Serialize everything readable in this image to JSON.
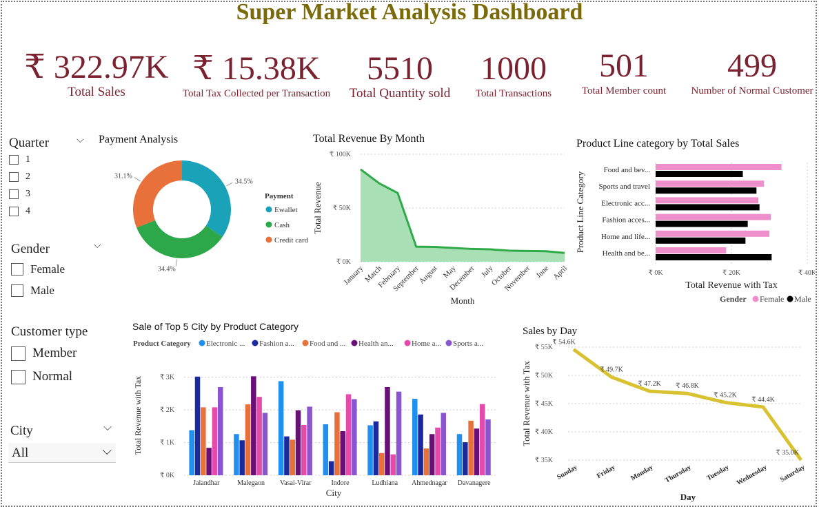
{
  "title": "Super Market Analysis Dashboard",
  "kpis": [
    {
      "value": "₹ 322.97K",
      "label": "Total Sales"
    },
    {
      "value": "₹ 15.38K",
      "label": "Total Tax Collected per Transaction"
    },
    {
      "value": "5510",
      "label": "Total Quantity sold"
    },
    {
      "value": "1000",
      "label": "Total Transactions"
    },
    {
      "value": "501",
      "label": "Total Member count"
    },
    {
      "value": "499",
      "label": "Number of Normal Customer"
    }
  ],
  "slicers": {
    "quarter": {
      "title": "Quarter",
      "options": [
        "1",
        "2",
        "3",
        "4"
      ]
    },
    "gender": {
      "title": "Gender",
      "options": [
        "Female",
        "Male"
      ]
    },
    "customer_type": {
      "title": "Customer type",
      "options": [
        "Member",
        "Normal"
      ]
    },
    "city": {
      "title": "City",
      "selected": "All"
    }
  },
  "colors": {
    "kpi": "#7a2230",
    "title": "#7a6a0a",
    "ewallet": "#1aa3b8",
    "cash": "#2ca84a",
    "credit_card": "#e8703a",
    "area_fill": "#a9dfb4",
    "area_line": "#2eaa48",
    "female": "#ee8fcb",
    "male": "#000000",
    "day_line": "#d9c232"
  },
  "chart_data": [
    {
      "type": "pie",
      "title": "Payment Analysis",
      "legend_title": "Payment",
      "legend_position": "right",
      "categories": [
        "Ewallet",
        "Cash",
        "Credit card"
      ],
      "values": [
        34.5,
        34.4,
        31.1
      ],
      "labels": [
        "34.5%",
        "34.4%",
        "31.1%"
      ]
    },
    {
      "type": "area",
      "title": "Total Revenue By Month",
      "xlabel": "Month",
      "ylabel": "Total Revenue",
      "ylim": [
        0,
        100000
      ],
      "yticks": [
        "₹ 0K",
        "₹ 50K",
        "₹ 100K"
      ],
      "categories": [
        "January",
        "March",
        "February",
        "September",
        "August",
        "May",
        "December",
        "July",
        "October",
        "November",
        "June",
        "April"
      ],
      "values": [
        86000,
        73000,
        64000,
        14000,
        13800,
        12800,
        11900,
        11500,
        10300,
        10000,
        9800,
        8200
      ]
    },
    {
      "type": "bar",
      "orientation": "horizontal",
      "title": "Product Line category by Total Sales",
      "xlabel": "Total Revenue with Tax",
      "ylabel": "Product Line Category",
      "xlim": [
        0,
        40000
      ],
      "xticks": [
        "₹ 0K",
        "₹ 20K",
        "₹ 40K"
      ],
      "legend_title": "Gender",
      "legend_position": "bottom-right",
      "categories": [
        "Food and bev...",
        "Sports and travel",
        "Electronic acc...",
        "Fashion acces...",
        "Home and life...",
        "Health and be..."
      ],
      "series": [
        {
          "name": "Female",
          "values": [
            33200,
            28600,
            27100,
            30400,
            30000,
            18600
          ]
        },
        {
          "name": "Male",
          "values": [
            23000,
            26600,
            27400,
            24300,
            23700,
            30600
          ]
        }
      ]
    },
    {
      "type": "bar",
      "title": "Sale of Top 5 City by Product Category",
      "xlabel": "City",
      "ylabel": "Total Revenue with Tax",
      "ylim": [
        0,
        3000
      ],
      "yticks": [
        "₹ 0K",
        "₹ 1K",
        "₹ 2K",
        "₹ 3K"
      ],
      "legend_title": "Product Category",
      "legend_position": "top",
      "categories": [
        "Jalandhar",
        "Malegaon",
        "Vasai-Virar",
        "Indore",
        "Ludhiana",
        "Ahmednagar",
        "Davanagere"
      ],
      "series": [
        {
          "name": "Electronic ...",
          "color": "#1f8ff0",
          "values": [
            1380,
            1260,
            2880,
            1560,
            1530,
            2340,
            1260
          ]
        },
        {
          "name": "Fashion a...",
          "color": "#1a2a9e",
          "values": [
            3020,
            1070,
            1190,
            430,
            1650,
            1860,
            1010
          ]
        },
        {
          "name": "Food and ...",
          "color": "#e8703a",
          "values": [
            2080,
            2170,
            1090,
            1930,
            680,
            820,
            1670
          ]
        },
        {
          "name": "Health an...",
          "color": "#6a0f78",
          "values": [
            840,
            3030,
            1990,
            1350,
            2700,
            1260,
            1430
          ]
        },
        {
          "name": "Home a...",
          "color": "#e64aaa",
          "values": [
            2080,
            2400,
            1540,
            2480,
            640,
            1460,
            2180
          ]
        },
        {
          "name": "Sports a...",
          "color": "#8a56d0",
          "values": [
            2700,
            1910,
            2100,
            2330,
            2560,
            1910,
            1710
          ]
        }
      ]
    },
    {
      "type": "line",
      "title": "Sales by Day",
      "xlabel": "Day",
      "ylabel": "Total Revenue with Tax",
      "ylim": [
        35000,
        55000
      ],
      "yticks": [
        "₹ 35K",
        "₹ 40K",
        "₹ 45K",
        "₹ 50K",
        "₹ 55K"
      ],
      "categories": [
        "Sunday",
        "Friday",
        "Monday",
        "Thursday",
        "Tuesday",
        "Wednesday",
        "Saturday"
      ],
      "values": [
        54600,
        49700,
        47200,
        46800,
        45200,
        44400,
        35000
      ],
      "labels": [
        "₹ 54.6K",
        "₹ 49.7K",
        "₹ 47.2K",
        "₹ 46.8K",
        "₹ 45.2K",
        "₹ 44.4K",
        "₹ 35.0K"
      ]
    }
  ]
}
